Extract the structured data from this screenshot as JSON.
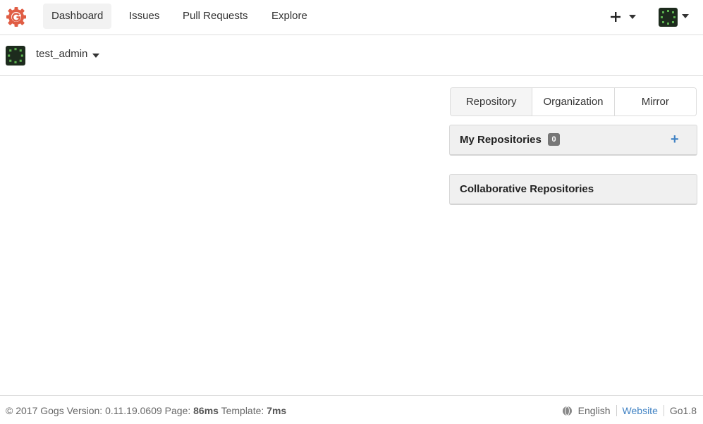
{
  "nav": {
    "items": [
      {
        "label": "Dashboard",
        "active": true
      },
      {
        "label": "Issues",
        "active": false
      },
      {
        "label": "Pull Requests",
        "active": false
      },
      {
        "label": "Explore",
        "active": false
      }
    ],
    "create_icon": "plus-icon",
    "logo_icon": "gogs-logo",
    "accent": "#e05d44"
  },
  "user": {
    "name": "test_admin"
  },
  "repo_tabs": [
    {
      "label": "Repository",
      "active": true
    },
    {
      "label": "Organization",
      "active": false
    },
    {
      "label": "Mirror",
      "active": false
    }
  ],
  "my_repos": {
    "title": "My Repositories",
    "count": "0",
    "add_label": "+"
  },
  "collab_repos": {
    "title": "Collaborative Repositories"
  },
  "footer": {
    "copyright": "© 2017 Gogs Version: 0.11.19.0609 Page: ",
    "page_time": "86ms",
    "template_prefix": " Template: ",
    "template_time": "7ms",
    "language": "English",
    "website": "Website",
    "go_version": "Go1.8"
  }
}
